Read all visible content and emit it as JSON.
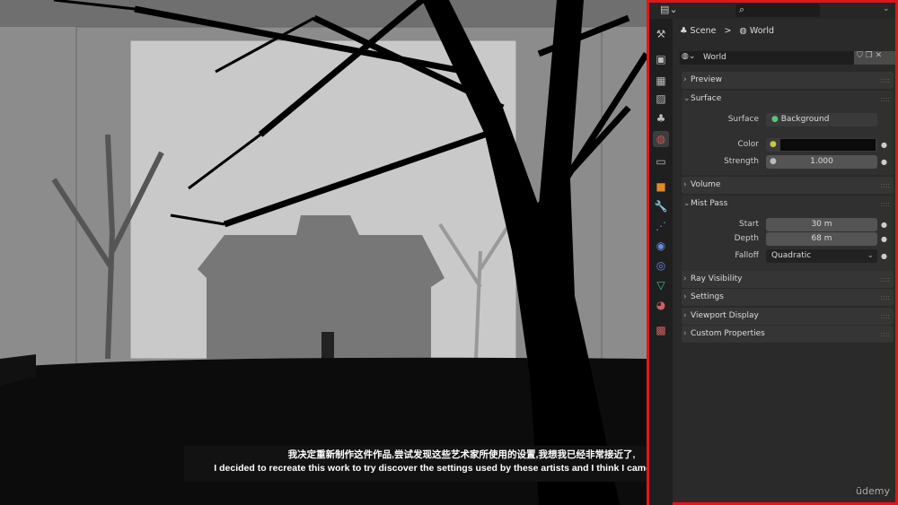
{
  "subtitles": {
    "zh": "我决定重新制作这件作品,尝试发现这些艺术家所使用的设置,我想我已经非常接近了,",
    "en": "I decided to recreate this work to try discover the settings used by these artists and I think I came pretty close,"
  },
  "panel": {
    "breadcrumb": {
      "scene": "Scene",
      "separator": ">",
      "world": "World"
    },
    "datablock": {
      "name": "World"
    },
    "sections": {
      "preview": "Preview",
      "surface": "Surface",
      "volume": "Volume",
      "mist_pass": "Mist Pass",
      "ray_visibility": "Ray Visibility",
      "settings": "Settings",
      "viewport_display": "Viewport Display",
      "custom_properties": "Custom Properties"
    },
    "surface": {
      "surface_label": "Surface",
      "surface_value": "Background",
      "color_label": "Color",
      "color_value": "#0a0a0a",
      "strength_label": "Strength",
      "strength_value": "1.000"
    },
    "mist": {
      "start_label": "Start",
      "start_value": "30 m",
      "depth_label": "Depth",
      "depth_value": "68 m",
      "falloff_label": "Falloff",
      "falloff_value": "Quadratic"
    }
  },
  "watermark": "ūdemy",
  "colors": {
    "highlight_border": "#e0161a",
    "panel_bg": "#2a2a2a"
  }
}
